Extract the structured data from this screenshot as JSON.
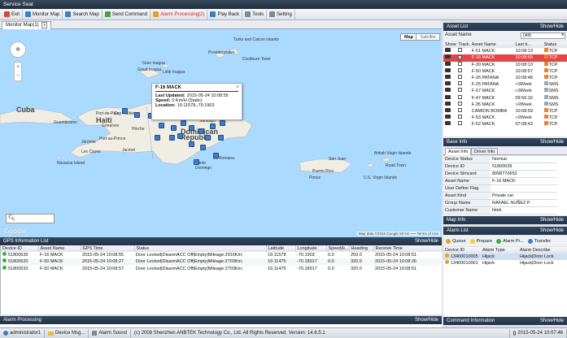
{
  "window": {
    "title": "Service Seat"
  },
  "toolbar": {
    "items": [
      {
        "label": "Exit",
        "icon": "exit-icon",
        "color": "#d24b3c"
      },
      {
        "label": "Monitor Map",
        "icon": "monitor-map-icon",
        "color": "#3a7ec9"
      },
      {
        "label": "Search Map",
        "icon": "search-map-icon",
        "color": "#3a7ec9"
      },
      {
        "label": "Send Command",
        "icon": "send-command-icon",
        "color": "#4aa04a"
      },
      {
        "label": "Alarm Processing(2)",
        "icon": "alarm-icon",
        "color": "#e8a020",
        "alert": true
      },
      {
        "label": "Play Back",
        "icon": "play-back-icon",
        "color": "#3a7ec9"
      },
      {
        "label": "Tools",
        "icon": "tools-icon",
        "color": "#7a8a9c"
      },
      {
        "label": "Setting",
        "icon": "setting-icon",
        "color": "#7a8a9c"
      }
    ]
  },
  "map_tab": {
    "label": "Monitor Map(1)",
    "close": "x"
  },
  "map": {
    "type_buttons": [
      "Map",
      "Satellite"
    ],
    "popup": {
      "title": "F-16 MACK",
      "lines": [
        {
          "k": "Last Updated:",
          "v": "2015-05-24 10:08:55"
        },
        {
          "k": "Speed:",
          "v": "0 Km/H (Static)"
        },
        {
          "k": "Location:",
          "v": "19.11578,-70.1903"
        }
      ]
    },
    "labels": [
      {
        "text": "Gran Inagua"
      },
      {
        "text": "Great Inagua"
      },
      {
        "text": "Little Inagua"
      },
      {
        "text": "Turks and Caicos Islands"
      },
      {
        "text": "Providenciales"
      },
      {
        "text": "Cockburn Town"
      },
      {
        "text": "Cuba"
      },
      {
        "text": "Haiti"
      },
      {
        "text": "Port-de-Paix"
      },
      {
        "text": "Gonaïves"
      },
      {
        "text": "Cap-Haïtien"
      },
      {
        "text": "Hinche"
      },
      {
        "text": "Port-au-Prince"
      },
      {
        "text": "Jacmel"
      },
      {
        "text": "Jérémie"
      },
      {
        "text": "Les Cayes"
      },
      {
        "text": "Santiago"
      },
      {
        "text": "Dominican"
      },
      {
        "text": "Republic"
      },
      {
        "text": "Santo"
      },
      {
        "text": "Domingo"
      },
      {
        "text": "La Romana"
      },
      {
        "text": "Puerto Rico"
      },
      {
        "text": "San Juan"
      },
      {
        "text": "Ponce"
      },
      {
        "text": "British Virgin Islands"
      },
      {
        "text": "Road Town"
      },
      {
        "text": "U.S. Virgin Islands"
      },
      {
        "text": "Guantánamo"
      },
      {
        "text": "Navassa Island"
      }
    ],
    "attribution": "Map data ©2015 Google   50 km ⎯⎯⎯   Terms of Use",
    "logo": "Google"
  },
  "gps_panel": {
    "title": "GPS Information List",
    "toggle": "Show/Hide",
    "columns": [
      "Device ID",
      "Asset Name",
      "GPS Time",
      "Status",
      "Latitude",
      "Longitude",
      "Speed(k...",
      "Heading",
      "Receive Time"
    ],
    "rows": [
      {
        "dot": "#3cb043",
        "cells": [
          "51800639",
          "F-16 MACK",
          "2015-05-24 10:08:55",
          "Door Locked|DisarmACC Off|Empty|Mileage:2916Km;",
          "19.11578",
          "-70.1903",
          "0.0",
          "250.0",
          "2015-05-24 10:08:51"
        ],
        "selected": false
      },
      {
        "dot": "#3cb043",
        "cells": [
          "51800633",
          "F-50 MACK",
          "2015-05-24 10:08:27",
          "Door Locked|DisarmACC Off|Empty|Mileage:2703Km;",
          "19.11475",
          "-70.18917",
          "0.0",
          "320.0",
          "2015-05-24 10:08:26"
        ],
        "selected": true
      },
      {
        "dot": "#3cb043",
        "cells": [
          "51800633",
          "F-50 MACK",
          "2015-05-24 10:08:57",
          "Door Locked|DisarmACC Off|Empty|Mileage:2703Km;",
          "19.11475",
          "-70.18917",
          "0.0",
          "320.0",
          "2015-05-24 10:08:51"
        ],
        "selected": false
      }
    ]
  },
  "alarm_processing": {
    "title": "Alarm Processing",
    "toggle": "Show/Hide"
  },
  "asset_list": {
    "title": "Asset List",
    "toggle": "Show/Hide",
    "filter_label": "Asset Name",
    "filter_value": "(All)",
    "columns": [
      "Show",
      "Track",
      "Asset Name",
      "Last ti...",
      "Status"
    ],
    "rows": [
      {
        "name": "F-51 MACK",
        "time": "10:08:13",
        "status": "TCP",
        "checked": false,
        "selected": false
      },
      {
        "name": "F-16 MACK",
        "time": "10:08:55",
        "status": "TCP",
        "checked": true,
        "selected": true
      },
      {
        "name": "F-30 MACK",
        "time": "10:08:13",
        "status": "TCP",
        "checked": false,
        "selected": false
      },
      {
        "name": "F-50 MACK",
        "time": "10:08:57",
        "status": "TCP",
        "checked": false,
        "selected": false
      },
      {
        "name": "F-26 PATANA",
        "time": "10:08:48",
        "status": "TCP",
        "checked": false,
        "selected": false
      },
      {
        "name": "F-25 PATANA",
        "time": ">3Week",
        "status": "SMS",
        "checked": false,
        "selected": false
      },
      {
        "name": "F-57 MACK",
        "time": ">3Week",
        "status": "SMS",
        "checked": false,
        "selected": false
      },
      {
        "name": "F-47 MACK",
        "time": "09:56:16",
        "status": "SMS",
        "checked": false,
        "selected": false
      },
      {
        "name": "F-35 MACK",
        "time": ">2Week",
        "status": "SMS",
        "checked": false,
        "selected": false
      },
      {
        "name": "CAMION BOMBA",
        "time": "10:08:59",
        "status": "TCP",
        "checked": false,
        "selected": false
      },
      {
        "name": "F-53 MACK",
        "time": ">2Week",
        "status": "TCP",
        "checked": false,
        "selected": false
      },
      {
        "name": "F-52 MACK",
        "time": "07:08:43",
        "status": "TCP",
        "checked": false,
        "selected": false
      }
    ]
  },
  "base_info": {
    "title": "Base Info",
    "toggle": "Show/Hide",
    "tabs": [
      "Asset Info",
      "Driver Info"
    ],
    "rows": [
      {
        "k": "Device Status",
        "v": "Normal"
      },
      {
        "k": "Device ID",
        "v": "51800639"
      },
      {
        "k": "Device Simcard",
        "v": "8098770652"
      },
      {
        "k": "Asset Name",
        "v": "F-16 MACK"
      },
      {
        "k": "User Define Flag",
        "v": ""
      },
      {
        "k": "Asset Kind",
        "v": "Private car"
      },
      {
        "k": "Group Name",
        "v": "RAFAEL NUÑEZ P"
      },
      {
        "k": "Customer Name",
        "v": "hitek"
      }
    ]
  },
  "map_info": {
    "title": "Map Info",
    "toggle": "Show/Hide"
  },
  "alarm_list": {
    "title": "Alarm List",
    "toggle": "Show/Hide",
    "filters": [
      {
        "label": "Queue",
        "color": "#e8a020"
      },
      {
        "label": "Prepare",
        "color": "#f0d030"
      },
      {
        "label": "Alarm Pr...",
        "color": "#3cb043"
      },
      {
        "label": "Transfer",
        "color": "#3a7ec9"
      }
    ],
    "columns": [
      "Device ID",
      "Alarm Type",
      "Alarm Describe"
    ],
    "rows": [
      {
        "cells": [
          "13400010005",
          "Hijack",
          "Hijack|Door Lock"
        ],
        "selected": true
      },
      {
        "cells": [
          "13400010001",
          "Hijack",
          "Hijack|Door Lock"
        ],
        "selected": false
      }
    ]
  },
  "command_info": {
    "title": "Command Information",
    "toggle": "Show/Hide"
  },
  "statusbar": {
    "user": "administrator1",
    "device_msg": "Device Msg...",
    "alarm_sound": "Alarm Sound",
    "copyright": "(c) 2008 Shenzhen ANBTEK Technology Co., Ltd. All Rights Reserved. Version: 14.6.5.1",
    "datetime": "2015-05-24 10:07:46"
  }
}
